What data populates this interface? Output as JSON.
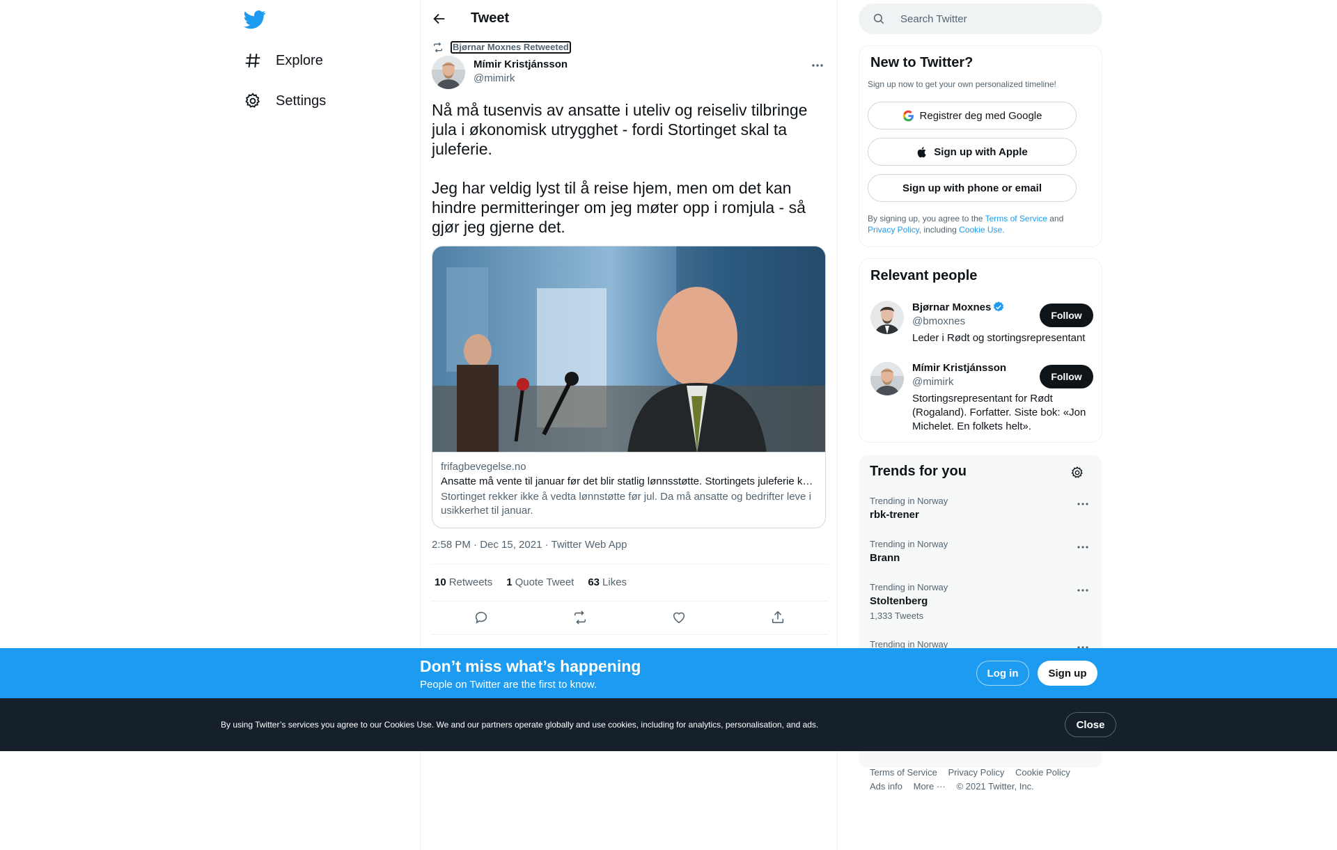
{
  "nav": {
    "logo": "twitter-bird-icon",
    "items": [
      {
        "label": "Explore",
        "icon": "hashtag-icon"
      },
      {
        "label": "Settings",
        "icon": "gear-icon"
      }
    ]
  },
  "header": {
    "title": "Tweet"
  },
  "tweet": {
    "retweeted_by": "Bjørnar Moxnes Retweeted",
    "author_name": "Mímir Kristjánsson",
    "author_handle": "@mimirk",
    "paragraphs": [
      "Nå må tusenvis av ansatte i uteliv og reiseliv tilbringe jula i økonomisk utrygghet - fordi Stortinget skal ta juleferie.",
      "Jeg har veldig lyst til å reise hjem, men om det kan hindre permitteringer om jeg møter opp i romjula - så gjør jeg gjerne det."
    ],
    "card": {
      "domain": "frifagbevegelse.no",
      "title": "Ansatte må vente til januar før det blir statlig lønnsstøtte. Stortingets juleferie kommer i veien",
      "description": "Stortinget rekker ikke å vedta lønnstøtte før jul. Da må ansatte og bedrifter leve i usikkerhet til januar."
    },
    "timestamp": "2:58 PM · Dec 15, 2021 · Twitter Web App",
    "stats": {
      "retweets_count": "10",
      "retweets_label": "Retweets",
      "quotes_count": "1",
      "quotes_label": "Quote Tweet",
      "likes_count": "63",
      "likes_label": "Likes"
    }
  },
  "search": {
    "placeholder": "Search Twitter"
  },
  "new_to_twitter": {
    "title": "New to Twitter?",
    "subtitle": "Sign up now to get your own personalized timeline!",
    "google_label": "Registrer deg med Google",
    "apple_label": "Sign up with Apple",
    "phone_label": "Sign up with phone or email",
    "legal_prefix": "By signing up, you agree to the ",
    "terms": "Terms of Service",
    "and": " and ",
    "privacy": "Privacy Policy",
    "including": ", including ",
    "cookie": "Cookie Use."
  },
  "relevant_people": {
    "title": "Relevant people",
    "people": [
      {
        "name": "Bjørnar Moxnes",
        "handle": "@bmoxnes",
        "bio": "Leder i Rødt og stortingsrepresentant",
        "follow": "Follow"
      },
      {
        "name": "Mímir Kristjánsson",
        "handle": "@mimirk",
        "bio": "Stortingsrepresentant for Rødt (Rogaland). Forfatter. Siste bok: «Jon Michelet. En folkets helt».",
        "follow": "Follow"
      }
    ]
  },
  "trends": {
    "title": "Trends for you",
    "items": [
      {
        "category": "Trending in Norway",
        "name": "rbk-trener",
        "count": ""
      },
      {
        "category": "Trending in Norway",
        "name": "Brann",
        "count": ""
      },
      {
        "category": "Trending in Norway",
        "name": "Stoltenberg",
        "count": "1,333 Tweets"
      },
      {
        "category": "Trending in Norway",
        "name": "",
        "count": ""
      }
    ]
  },
  "footer": {
    "terms": "Terms of Service",
    "privacy": "Privacy Policy",
    "cookie": "Cookie Policy",
    "ads": "Ads info",
    "more": "More ···",
    "copyright": "© 2021 Twitter, Inc."
  },
  "bottom_bar": {
    "title": "Don’t miss what’s happening",
    "subtitle": "People on Twitter are the first to know.",
    "login": "Log in",
    "signup": "Sign up"
  },
  "cookie_bar": {
    "text": "By using Twitter’s services you agree to our Cookies Use. We and our partners operate globally and use cookies, including for analytics, personalisation, and ads.",
    "close": "Close"
  },
  "colors": {
    "accent": "#1d9bf0",
    "text": "#0f1419",
    "secondary": "#536471",
    "cookie_bg": "#15202b"
  }
}
